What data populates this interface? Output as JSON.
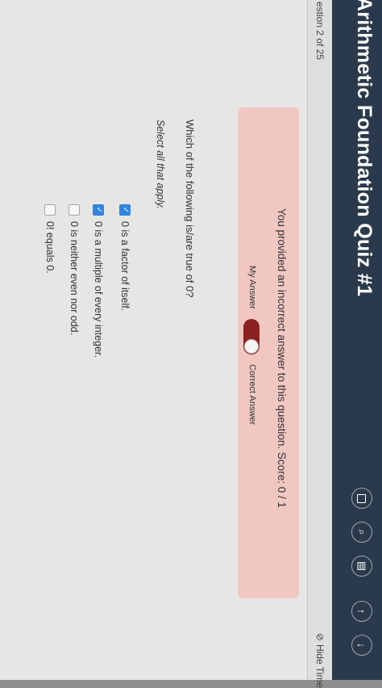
{
  "header": {
    "title": "Arithmetic Foundation Quiz #1",
    "icons": [
      "square-icon",
      "search-icon",
      "book-icon",
      "arrow-up-icon",
      "arrow-down-icon"
    ],
    "color": "#2a3a4c"
  },
  "subbar": {
    "question_counter": "estion 2 of 25",
    "hide_timer_label": "Hide Time"
  },
  "feedback": {
    "message": "You provided an incorrect answer to this question. Score: 0 / 1",
    "my_answer_label": "My Answer",
    "correct_answer_label": "Correct Answer",
    "color": "#f1c7c2",
    "toggle_color": "#8c2121"
  },
  "question": {
    "text": "Which of the following is/are true of 0?",
    "instruction": "Select all that apply.",
    "options": [
      {
        "label": "0 is a factor of itself.",
        "checked": true
      },
      {
        "label": "0 is a multiple of every integer.",
        "checked": true
      },
      {
        "label": "0 is neither even nor odd.",
        "checked": false
      },
      {
        "label": "0! equals 0.",
        "checked": false
      }
    ],
    "check_color": "#2f86e0"
  }
}
